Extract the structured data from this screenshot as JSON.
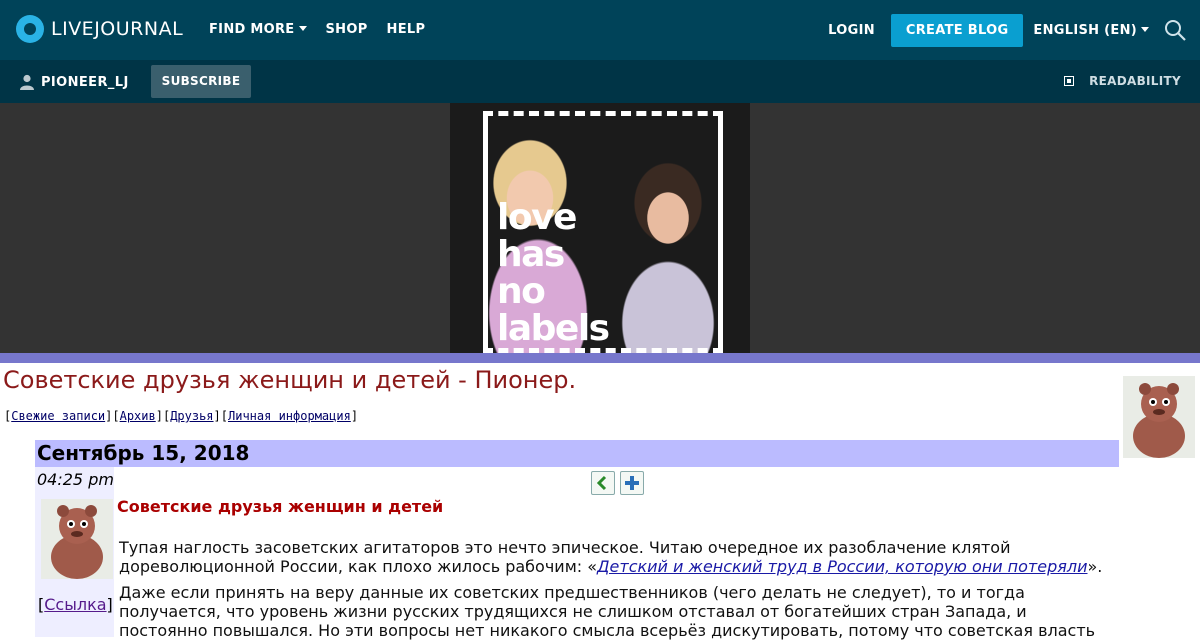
{
  "header": {
    "logo_text": "LIVEJOURNAL",
    "nav": [
      "FIND MORE",
      "SHOP",
      "HELP"
    ],
    "login": "LOGIN",
    "create_blog": "CREATE BLOG",
    "language": "ENGLISH (EN)",
    "accent_color": "#0a9fd0",
    "bar_color": "#004359"
  },
  "subheader": {
    "username": "PIONEER_LJ",
    "subscribe": "SUBSCRIBE",
    "readability": "READABILITY"
  },
  "ad": {
    "slogan": [
      "love",
      "has",
      "no",
      "labels"
    ]
  },
  "journal": {
    "title": "Советские друзья женщин и детей - Пионер.",
    "links": [
      "Свежие записи",
      "Архив",
      "Друзья",
      "Личная информация"
    ],
    "date": "Сентябрь 15, 2018",
    "time": "04:25 pm",
    "link_label": "Ссылка"
  },
  "post": {
    "title": "Советские друзья женщин и детей",
    "p1_line1": "Тупая наглость засоветских агитаторов это нечто эпическое. Читаю очередное их разоблачение клятой",
    "p1_line2_before": "дореволюционной России, как плохо жилось рабочим: «",
    "p1_link": "Детский и женский труд в России, которую они потеряли",
    "p1_line2_after": "».",
    "p2_line1": "Даже если принять на веру данные их советских предшественников (чего делать не следует), то и тогда",
    "p2_line2": "получается, что уровень жизни русских трудящихся не слишком отставал от богатейших стран Запада, и",
    "p2_line3": "постоянно повышался. Но эти вопросы нет никакого смысла всерьёз дискутировать, потому что советская власть"
  }
}
